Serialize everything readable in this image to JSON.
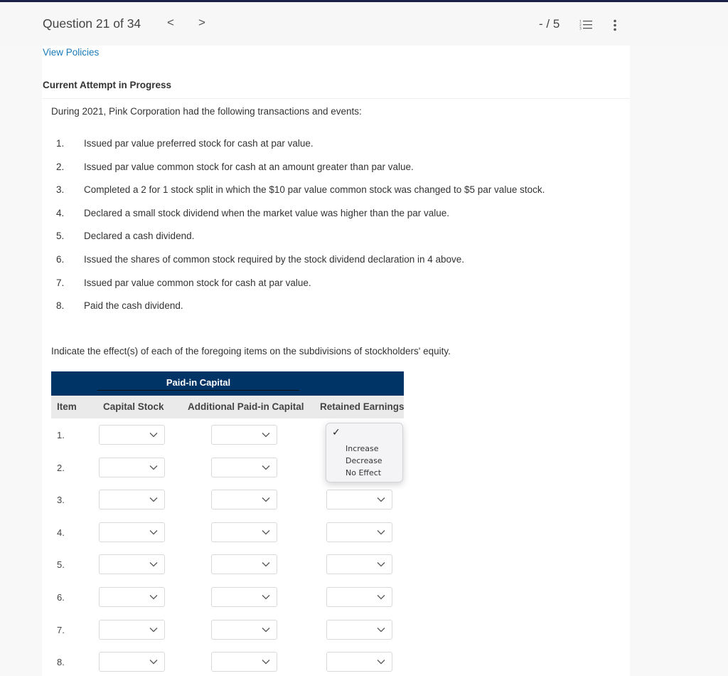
{
  "header": {
    "question_label": "Question 21 of 34",
    "prev_icon": "chevron-left-icon",
    "next_icon": "chevron-right-icon",
    "prev_glyph": "<",
    "next_glyph": ">",
    "score": "- / 5",
    "list_icon": "numbered-list-icon",
    "more_icon": "more-vertical-icon"
  },
  "content": {
    "view_policies": "View Policies",
    "attempt_status": "Current Attempt in Progress",
    "intro": "During 2021, Pink Corporation had the following transactions and events:",
    "transactions": [
      {
        "num": "1.",
        "text": "Issued par value preferred stock for cash at par value."
      },
      {
        "num": "2.",
        "text": "Issued par value common stock for cash at an amount greater than par value."
      },
      {
        "num": "3.",
        "text": "Completed a 2 for 1 stock split in which the $10 par value common stock was changed to $5 par value stock."
      },
      {
        "num": "4.",
        "text": "Declared a small stock dividend when the market value was higher than the par value."
      },
      {
        "num": "5.",
        "text": "Declared a cash dividend."
      },
      {
        "num": "6.",
        "text": "Issued the shares of common stock required by the stock dividend declaration in 4 above."
      },
      {
        "num": "7.",
        "text": "Issued par value common stock for cash at par value."
      },
      {
        "num": "8.",
        "text": "Paid the cash dividend."
      }
    ],
    "instruction": "Indicate the effect(s) of each of the foregoing items on the subdivisions of stockholders' equity."
  },
  "table": {
    "group_header": "Paid-in Capital",
    "columns": [
      "Item",
      "Capital Stock",
      "Additional Paid-in Capital",
      "Retained Earnings"
    ],
    "rows": [
      {
        "item": "1.",
        "capital_stock": "",
        "apic": "",
        "retained_earnings": ""
      },
      {
        "item": "2.",
        "capital_stock": "",
        "apic": "",
        "retained_earnings": ""
      },
      {
        "item": "3.",
        "capital_stock": "",
        "apic": "",
        "retained_earnings": ""
      },
      {
        "item": "4.",
        "capital_stock": "",
        "apic": "",
        "retained_earnings": ""
      },
      {
        "item": "5.",
        "capital_stock": "",
        "apic": "",
        "retained_earnings": ""
      },
      {
        "item": "6.",
        "capital_stock": "",
        "apic": "",
        "retained_earnings": ""
      },
      {
        "item": "7.",
        "capital_stock": "",
        "apic": "",
        "retained_earnings": ""
      },
      {
        "item": "8.",
        "capital_stock": "",
        "apic": "",
        "retained_earnings": ""
      }
    ],
    "open_dropdown": {
      "row": "1.",
      "column": "Retained Earnings",
      "check_glyph": "✓",
      "options": [
        "",
        "Increase",
        "Decrease",
        "No Effect"
      ],
      "selected_index": 0
    }
  },
  "colors": {
    "topbar": "#1a2147",
    "table_header": "#003366",
    "link": "#1a7ab8"
  }
}
